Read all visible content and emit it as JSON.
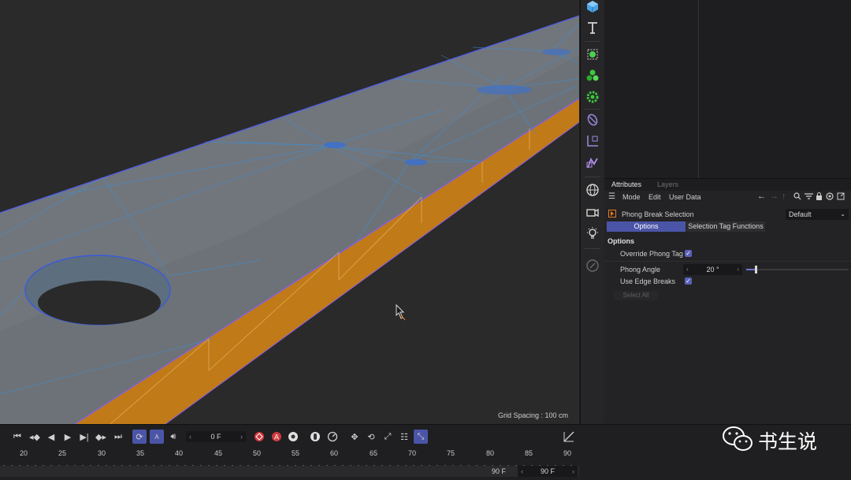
{
  "viewport": {
    "grid_spacing_label": "Grid Spacing : 100 cm"
  },
  "sidebar": {
    "icons": [
      "cube-icon",
      "text-icon",
      "null-object-icon",
      "cloner-icon",
      "generator-gear-icon",
      "deformer-icon",
      "field-icon",
      "spline-icon",
      "scene-globe-icon",
      "camera-icon",
      "light-icon",
      "render-icon"
    ]
  },
  "attributes": {
    "tabs": [
      "Attributes",
      "Layers"
    ],
    "menu": [
      "Mode",
      "Edit",
      "User Data"
    ],
    "object_name": "Phong Break Selection",
    "preset": "Default",
    "subtabs": [
      "Options",
      "Selection Tag Functions"
    ],
    "section_title": "Options",
    "override_phong_label": "Override Phong Tag",
    "phong_angle_label": "Phong Angle",
    "phong_angle_value": "20 °",
    "edge_breaks_label": "Use Edge Breaks",
    "select_all_label": "Select All"
  },
  "timeline": {
    "current_frame": "0 F",
    "ruler_labels": [
      "20",
      "25",
      "30",
      "35",
      "40",
      "45",
      "50",
      "55",
      "60",
      "65",
      "70",
      "75",
      "80",
      "85",
      "90"
    ],
    "end_frame": "90 F",
    "end_frame_field": "90 F"
  },
  "watermark": {
    "text": "书生说"
  },
  "colors": {
    "accent": "#4b55a8",
    "wireframe": "#3a8fd8",
    "edge": "#d98a1a"
  }
}
